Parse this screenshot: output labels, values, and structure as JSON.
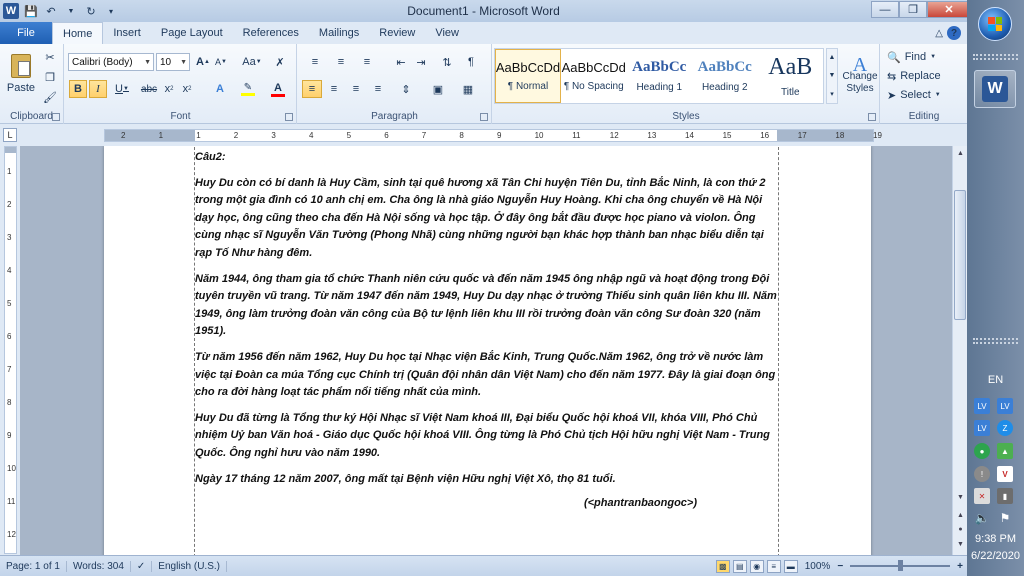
{
  "window": {
    "title": "Document1 - Microsoft Word",
    "minimize_icon": "minimize-icon",
    "maximize_icon": "restore-icon",
    "close_icon": "close-icon"
  },
  "tabs": {
    "file": "File",
    "items": [
      "Home",
      "Insert",
      "Page Layout",
      "References",
      "Mailings",
      "Review",
      "View"
    ]
  },
  "ribbon": {
    "clipboard": {
      "label": "Clipboard",
      "paste": "Paste"
    },
    "font": {
      "label": "Font",
      "font_name": "Calibri (Body)",
      "font_size": "10",
      "grow": "A",
      "shrink": "A",
      "change_case": "Aa",
      "bold": "B",
      "italic": "I",
      "underline": "U",
      "strike": "abc",
      "subscript": "x",
      "superscript": "x",
      "highlight_color": "#ffff00",
      "font_color": "#ff0000"
    },
    "paragraph": {
      "label": "Paragraph"
    },
    "styles": {
      "label": "Styles",
      "items": [
        {
          "sample": "AaBbCcDd",
          "name": "¶ Normal"
        },
        {
          "sample": "AaBbCcDd",
          "name": "¶ No Spacing"
        },
        {
          "sample": "AaBbCc",
          "name": "Heading 1"
        },
        {
          "sample": "AaBbCc",
          "name": "Heading 2"
        },
        {
          "sample": "AaB",
          "name": "Title"
        }
      ],
      "change_styles": "Change Styles"
    },
    "editing": {
      "label": "Editing",
      "find": "Find",
      "replace": "Replace",
      "select": "Select"
    }
  },
  "ruler": {
    "ticks": [
      "2",
      "1",
      "1",
      "2",
      "3",
      "4",
      "5",
      "6",
      "7",
      "8",
      "9",
      "10",
      "11",
      "12",
      "13",
      "14",
      "15",
      "16",
      "17",
      "18",
      "19"
    ],
    "vticks": [
      "1",
      "2",
      "3",
      "4",
      "5",
      "6",
      "7",
      "8",
      "9",
      "10",
      "11",
      "12"
    ],
    "corner": "L"
  },
  "document": {
    "paragraphs": [
      "Câu2:",
      "Huy Du còn có bí danh là Huy Cầm, sinh tại quê hương xã Tân Chi huyện Tiên Du, tỉnh Bắc Ninh, là con thứ 2 trong một gia đình có 10 anh chị em. Cha ông là nhà giáo Nguyễn Huy Hoàng. Khi cha ông chuyển về Hà Nội dạy học, ông cũng theo cha đến Hà Nội sống và học tập. Ở đây ông bắt đầu được học piano và violon. Ông cùng nhạc sĩ Nguyễn Văn Tường (Phong Nhã) cùng những người bạn khác hợp thành ban nhạc biểu diễn tại rạp Tố Như hàng đêm.",
      "Năm 1944, ông tham gia tổ chức Thanh niên cứu quốc và đến năm 1945 ông nhập ngũ và hoạt động trong Đội tuyên truyền vũ trang. Từ năm 1947 đến năm 1949, Huy Du dạy nhạc ở trường Thiếu sinh quân liên khu III. Năm 1949, ông làm trưởng đoàn văn công của Bộ tư lệnh liên khu III rồi trưởng đoàn văn công Sư đoàn 320 (năm 1951).",
      "Từ năm 1956 đến năm 1962, Huy Du học tại Nhạc viện Bắc Kinh, Trung Quốc.Năm 1962, ông trở về nước làm việc tại Đoàn ca múa Tổng cục Chính trị (Quân đội nhân dân Việt Nam) cho đến năm 1977. Đây là giai đoạn ông cho ra đời hàng loạt tác phẩm nổi tiếng nhất của mình.",
      "Huy Du đã từng là Tổng thư ký Hội Nhạc sĩ Việt Nam khoá III, Đại biểu Quốc hội khoá VII, khóa VIII, Phó Chủ nhiệm Uỷ ban Văn hoá - Giáo dục Quốc hội khoá VIII. Ông từng là Phó Chủ tịch Hội hữu nghị Việt Nam - Trung Quốc. Ông nghỉ hưu vào năm 1990.",
      "Ngày 17 tháng 12 năm 2007, ông mất tại Bệnh viện Hữu nghị Việt Xô, thọ 81 tuổi."
    ],
    "signature": "(<phantranbaongoc>)"
  },
  "status": {
    "page": "Page: 1 of 1",
    "words": "Words: 304",
    "language": "English (U.S.)",
    "zoom": "100%",
    "zoom_level": 1.0
  },
  "taskbar": {
    "language": "EN",
    "time": "9:38 PM",
    "date": "6/22/2020"
  }
}
